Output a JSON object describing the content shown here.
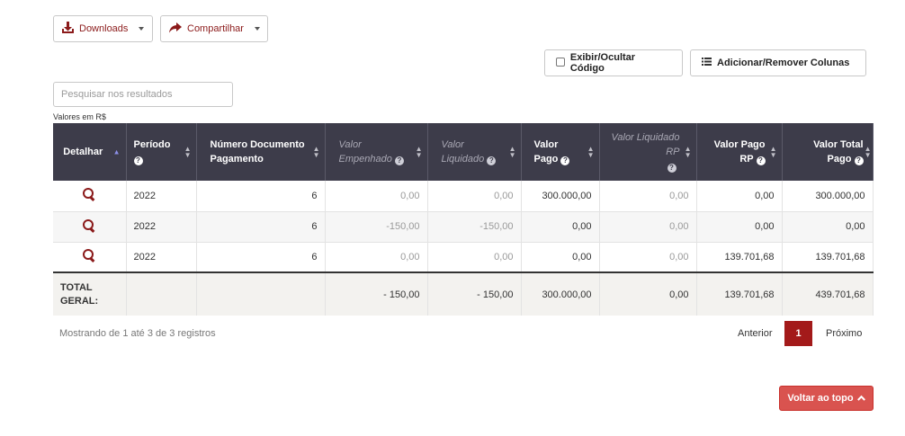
{
  "toolbar": {
    "downloads_label": "Downloads",
    "share_label": "Compartilhar",
    "toggle_code_label": "Exibir/Ocultar Código",
    "columns_label": "Adicionar/Remover Colunas"
  },
  "search": {
    "placeholder": "Pesquisar nos resultados"
  },
  "currency_note": "Valores em R$",
  "table": {
    "headers": {
      "detalhar": "Detalhar",
      "periodo": "Período",
      "numero_doc": "Número Documento Pagamento",
      "valor_empenhado": "Valor Empenhado",
      "valor_liquidado": "Valor Liquidado",
      "valor_pago": "Valor Pago",
      "valor_liquidado_rp": "Valor Liquidado RP",
      "valor_pago_rp": "Valor Pago RP",
      "valor_total_pago": "Valor Total Pago"
    },
    "rows": [
      {
        "periodo": "2022",
        "numero": "6",
        "empenhado": "0,00",
        "liquidado": "0,00",
        "pago": "300.000,00",
        "liquidado_rp": "0,00",
        "pago_rp": "0,00",
        "total_pago": "300.000,00"
      },
      {
        "periodo": "2022",
        "numero": "6",
        "empenhado": "-150,00",
        "liquidado": "-150,00",
        "pago": "0,00",
        "liquidado_rp": "0,00",
        "pago_rp": "0,00",
        "total_pago": "0,00"
      },
      {
        "periodo": "2022",
        "numero": "6",
        "empenhado": "0,00",
        "liquidado": "0,00",
        "pago": "0,00",
        "liquidado_rp": "0,00",
        "pago_rp": "139.701,68",
        "total_pago": "139.701,68"
      }
    ],
    "total": {
      "label": "TOTAL GERAL:",
      "empenhado": "- 150,00",
      "liquidado": "- 150,00",
      "pago": "300.000,00",
      "liquidado_rp": "0,00",
      "pago_rp": "139.701,68",
      "total_pago": "439.701,68"
    }
  },
  "footer": {
    "info": "Mostrando de 1 até 3 de 3 registros",
    "prev": "Anterior",
    "current_page": "1",
    "next": "Próximo"
  },
  "back_to_top": "Voltar ao topo",
  "icons": {
    "download": "download-icon",
    "share": "share-icon",
    "list": "list-icon",
    "detail": "magnifier-icon",
    "up": "chevron-up-icon"
  },
  "colors": {
    "brand": "#8b1a1a",
    "header_bg": "#3d3c4a",
    "active_page": "#a31a1a",
    "back_to_top": "#d9534f"
  }
}
